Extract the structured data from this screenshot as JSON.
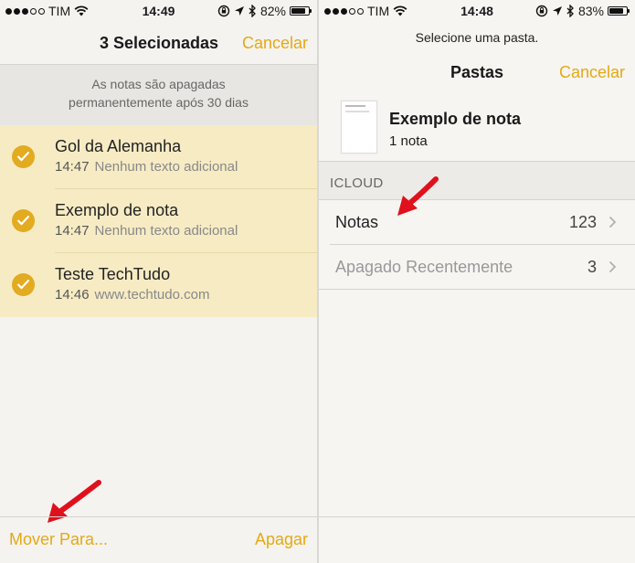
{
  "left": {
    "status": {
      "carrier": "TIM",
      "time": "14:49",
      "battery": "82%",
      "battery_level": 0.82
    },
    "header": {
      "title": "3 Selecionadas",
      "cancel_label": "Cancelar"
    },
    "notice": {
      "line1": "As notas são apagadas",
      "line2": "permanentemente após 30 dias"
    },
    "notes": [
      {
        "title": "Gol da Alemanha",
        "time": "14:47",
        "snippet": "Nenhum texto adicional",
        "selected": true
      },
      {
        "title": "Exemplo de nota",
        "time": "14:47",
        "snippet": "Nenhum texto adicional",
        "selected": true
      },
      {
        "title": "Teste TechTudo",
        "time": "14:46",
        "snippet": "www.techtudo.com",
        "selected": true
      }
    ],
    "toolbar": {
      "move_label": "Mover Para...",
      "delete_label": "Apagar"
    }
  },
  "right": {
    "status": {
      "carrier": "TIM",
      "time": "14:48",
      "battery": "83%",
      "battery_level": 0.83
    },
    "prompt": "Selecione uma pasta.",
    "header": {
      "title": "Pastas",
      "cancel_label": "Cancelar"
    },
    "note_preview": {
      "title": "Exemplo de nota",
      "count": "1 nota"
    },
    "section": "ICLOUD",
    "folders": [
      {
        "name": "Notas",
        "count": "123"
      },
      {
        "name": "Apagado Recentemente",
        "count": "3"
      }
    ]
  },
  "colors": {
    "accent": "#e5a913",
    "selected_row": "#f7ebc4",
    "check": "#e2ab20",
    "arrow": "#e0101c"
  },
  "icons": [
    "wifi-icon",
    "rotation-lock-icon",
    "location-arrow-icon",
    "bluetooth-icon",
    "battery-icon",
    "checkmark-icon",
    "chevron-right-icon",
    "annotation-arrow-icon"
  ]
}
